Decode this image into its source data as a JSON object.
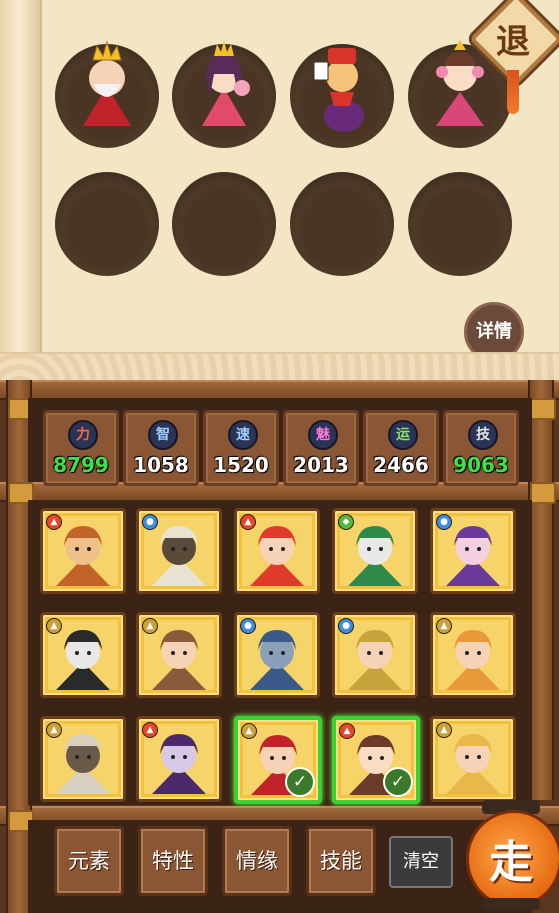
{
  "top_panel": {
    "retreat_label": "退",
    "details_label": "详情",
    "slots": [
      {
        "filled": true,
        "icon": "king-avatar"
      },
      {
        "filled": true,
        "icon": "queen-avatar"
      },
      {
        "filled": true,
        "icon": "jester-avatar"
      },
      {
        "filled": true,
        "icon": "princess-avatar"
      },
      {
        "filled": false
      },
      {
        "filled": false
      },
      {
        "filled": false
      },
      {
        "filled": false
      }
    ]
  },
  "stats": [
    {
      "label": "力",
      "value": "8799",
      "value_color": "green"
    },
    {
      "label": "智",
      "value": "1058",
      "value_color": "white"
    },
    {
      "label": "速",
      "value": "1520",
      "value_color": "white"
    },
    {
      "label": "魅",
      "value": "2013",
      "value_color": "white"
    },
    {
      "label": "运",
      "value": "2466",
      "value_color": "white"
    },
    {
      "label": "技",
      "value": "9063",
      "value_color": "green"
    }
  ],
  "characters": [
    {
      "icon": "monkey-king-portrait",
      "element": "fire",
      "selected": false
    },
    {
      "icon": "scholar-portrait",
      "element": "water",
      "selected": false
    },
    {
      "icon": "golden-warrior-portrait",
      "element": "fire",
      "selected": false
    },
    {
      "icon": "joker-portrait",
      "element": "wood",
      "selected": false
    },
    {
      "icon": "witch-portrait",
      "element": "water",
      "selected": false
    },
    {
      "icon": "masked-duo-portrait",
      "element": "earth",
      "selected": false
    },
    {
      "icon": "glasses-girl-portrait",
      "element": "earth",
      "selected": false
    },
    {
      "icon": "stone-golem-portrait",
      "element": "water",
      "selected": false
    },
    {
      "icon": "sun-mask-portrait",
      "element": "water",
      "selected": false
    },
    {
      "icon": "tiger-hat-portrait",
      "element": "earth",
      "selected": false
    },
    {
      "icon": "bulldog-portrait",
      "element": "earth",
      "selected": false
    },
    {
      "icon": "sorcerer-portrait",
      "element": "fire",
      "selected": false
    },
    {
      "icon": "king-portrait",
      "element": "earth",
      "selected": true
    },
    {
      "icon": "princess-portrait",
      "element": "fire",
      "selected": true
    },
    {
      "icon": "dancer-portrait",
      "element": "earth",
      "selected": false
    }
  ],
  "buttons": {
    "elements": "元素",
    "traits": "特性",
    "bond": "情缘",
    "skills": "技能",
    "clear": "清空",
    "go": "走"
  },
  "colors": {
    "parchment": "#f3e6c4",
    "wood": "#8a5634",
    "selected_border": "#3bd12e",
    "stat_green": "#3fe04a"
  }
}
